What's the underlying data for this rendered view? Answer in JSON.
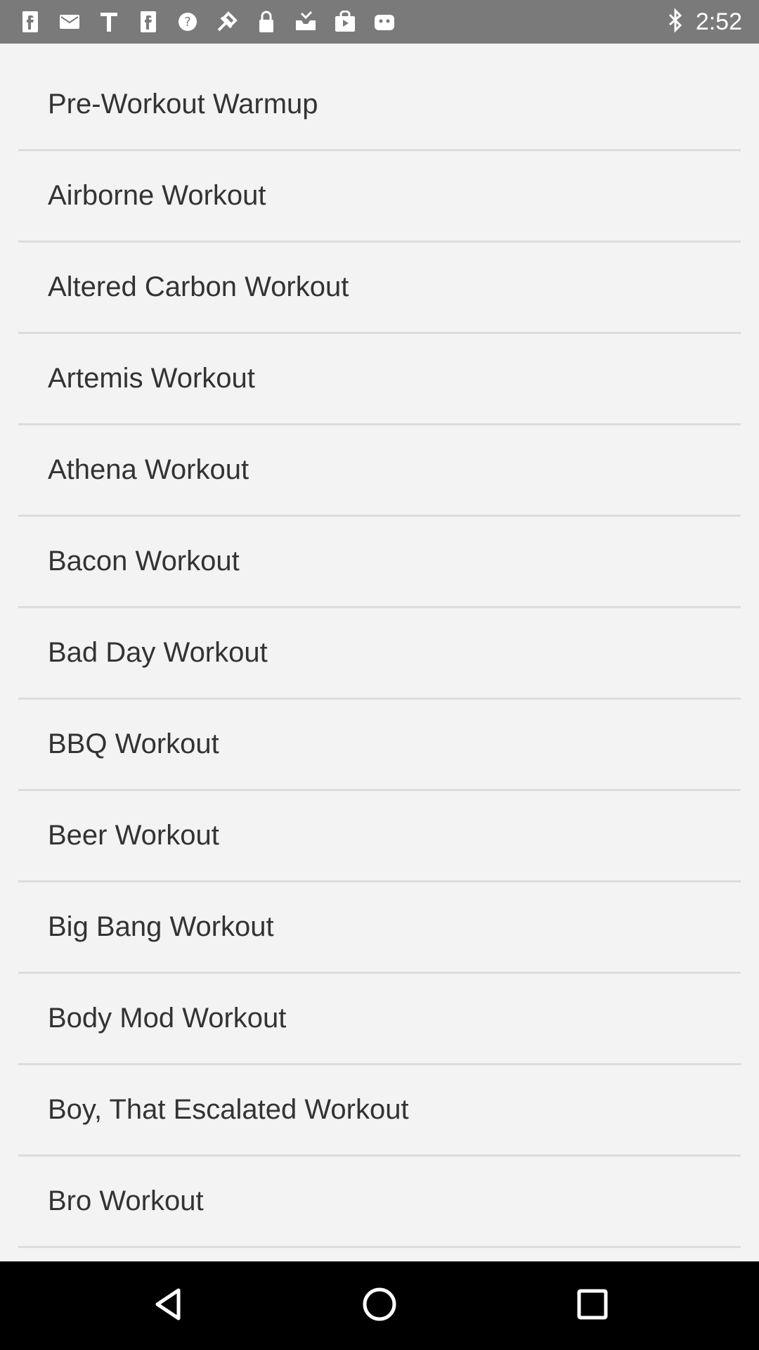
{
  "status_bar": {
    "time": "2:52",
    "left_icons": [
      "f-icon",
      "mail-icon",
      "t-icon",
      "f-icon",
      "help-icon",
      "fake-gps-icon",
      "lock-icon",
      "inbox-icon",
      "play-store-icon",
      "android-icon"
    ],
    "right_icons": [
      "bluetooth-icon"
    ]
  },
  "workout_list": {
    "items": [
      {
        "label": "Pre-Workout Warmup"
      },
      {
        "label": "Airborne Workout"
      },
      {
        "label": "Altered Carbon Workout"
      },
      {
        "label": "Artemis Workout"
      },
      {
        "label": "Athena Workout"
      },
      {
        "label": "Bacon Workout"
      },
      {
        "label": "Bad Day Workout"
      },
      {
        "label": "BBQ Workout"
      },
      {
        "label": "Beer Workout"
      },
      {
        "label": "Big Bang Workout"
      },
      {
        "label": "Body Mod Workout"
      },
      {
        "label": "Boy, That Escalated Workout"
      },
      {
        "label": "Bro Workout"
      }
    ]
  },
  "nav_bar": {
    "buttons": [
      "back-icon",
      "home-icon",
      "recents-icon"
    ]
  },
  "colors": {
    "status_bar_bg": "#7a7a7a",
    "page_bg": "#f3f3f3",
    "divider": "#dcdcdc",
    "text": "#333333",
    "nav_bar_bg": "#000000"
  }
}
